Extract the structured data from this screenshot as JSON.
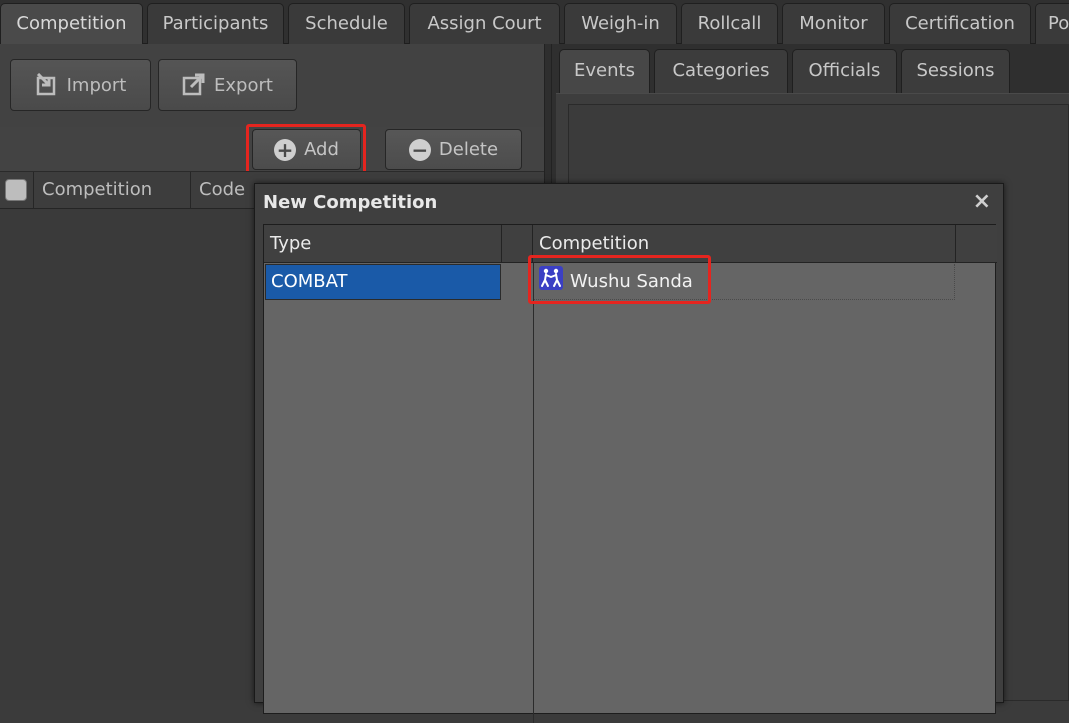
{
  "top_tabs": [
    {
      "label": "Competition",
      "active": true
    },
    {
      "label": "Participants"
    },
    {
      "label": "Schedule"
    },
    {
      "label": "Assign Court"
    },
    {
      "label": "Weigh-in"
    },
    {
      "label": "Rollcall"
    },
    {
      "label": "Monitor"
    },
    {
      "label": "Certification"
    },
    {
      "label": "Po"
    }
  ],
  "toolbar": {
    "import_label": "Import",
    "export_label": "Export",
    "add_label": "Add",
    "delete_label": "Delete"
  },
  "grid": {
    "col_competition": "Competition",
    "col_code": "Code"
  },
  "sub_tabs": [
    {
      "label": "Events",
      "active": true
    },
    {
      "label": "Categories"
    },
    {
      "label": "Officials"
    },
    {
      "label": "Sessions"
    }
  ],
  "dialog": {
    "title": "New Competition",
    "close": "×",
    "col_type": "Type",
    "col_competition": "Competition",
    "type_selected": "COMBAT",
    "competition_item": "Wushu Sanda"
  },
  "colors": {
    "highlight": "#e5251f",
    "selection": "#1a5aa8"
  }
}
